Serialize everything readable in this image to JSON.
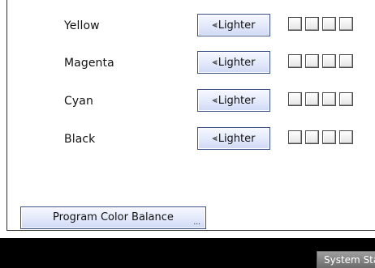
{
  "colors": [
    {
      "label": "Yellow",
      "button_label": "Lighter",
      "button_arrow": "⫷"
    },
    {
      "label": "Magenta",
      "button_label": "Lighter",
      "button_arrow": "⫷"
    },
    {
      "label": "Cyan",
      "button_label": "Lighter",
      "button_arrow": "⫷"
    },
    {
      "label": "Black",
      "button_label": "Lighter",
      "button_arrow": "⫷"
    }
  ],
  "program_button": {
    "label": "Program Color Balance",
    "ellipsis": "..."
  },
  "status_button": {
    "label": "System Status"
  },
  "theme": {
    "button_border": "#3a4f88",
    "button_fill": "#e3e9fb",
    "status_fill": "#8a8a8a",
    "background": "#ffffff"
  }
}
